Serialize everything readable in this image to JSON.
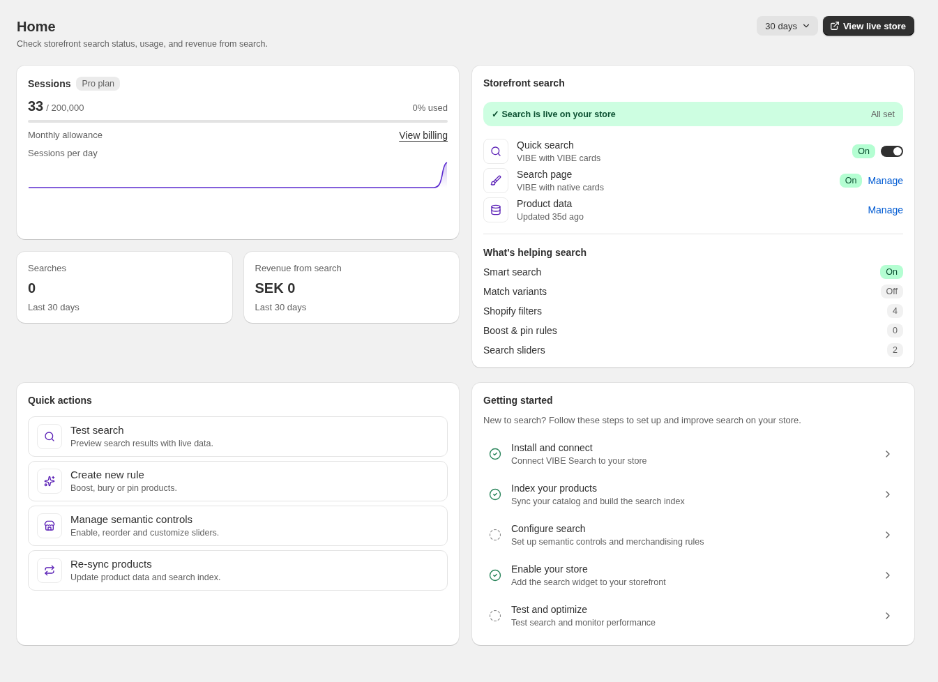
{
  "header": {
    "title": "Home",
    "subtitle": "Check storefront search status, usage, and revenue from search.",
    "period_select": {
      "value": "30 days"
    },
    "view_store_button": "View live store"
  },
  "sessions": {
    "title": "Sessions",
    "plan_badge": "Pro plan",
    "count": "33",
    "limit": "/ 200,000",
    "usage": "0% used",
    "allowance_label": "Monthly allowance",
    "billing_link": "View billing",
    "chart_title": "Sessions per day"
  },
  "stats": [
    {
      "label": "Searches",
      "value": "0",
      "period": "Last 30 days"
    },
    {
      "label": "Revenue from search",
      "value": "SEK 0",
      "period": "Last 30 days"
    }
  ],
  "storefront": {
    "title": "Storefront search",
    "banner": {
      "check": "✓",
      "message": "Search is live on your store",
      "status": "All set"
    },
    "features": [
      {
        "title": "Quick search",
        "subtitle": "VIBE with VIBE cards",
        "badge": {
          "label": "On",
          "active": true
        },
        "toggle": {
          "on": true
        }
      },
      {
        "title": "Search page",
        "subtitle": "VIBE with native cards",
        "badge": {
          "label": "On",
          "active": true
        },
        "action": "Manage"
      },
      {
        "title": "Product data",
        "subtitle": "Updated 35d ago",
        "action": "Manage"
      }
    ],
    "helpers_title": "What's helping search",
    "helpers": [
      {
        "label": "Smart search",
        "badge": {
          "label": "On",
          "active": true
        }
      },
      {
        "label": "Match variants",
        "badge": {
          "label": "Off",
          "active": false
        }
      },
      {
        "label": "Shopify filters",
        "badge": {
          "label": "4",
          "active": false
        }
      },
      {
        "label": "Boost & pin rules",
        "badge": {
          "label": "0",
          "active": false
        }
      },
      {
        "label": "Search sliders",
        "badge": {
          "label": "2",
          "active": false
        }
      }
    ]
  },
  "quick_actions": {
    "title": "Quick actions",
    "items": [
      {
        "title": "Test search",
        "description": "Preview search results with live data."
      },
      {
        "title": "Create new rule",
        "description": "Boost, bury or pin products."
      },
      {
        "title": "Manage semantic controls",
        "description": "Enable, reorder and customize sliders."
      },
      {
        "title": "Re-sync products",
        "description": "Update product data and search index."
      }
    ]
  },
  "getting_started": {
    "title": "Getting started",
    "description": "New to search? Follow these steps to set up and improve search on your store.",
    "steps": [
      {
        "title": "Install and connect",
        "description": "Connect VIBE Search to your store",
        "done": true
      },
      {
        "title": "Index your products",
        "description": "Sync your catalog and build the search index",
        "done": true
      },
      {
        "title": "Configure search",
        "description": "Set up semantic controls and merchandising rules",
        "done": false
      },
      {
        "title": "Enable your store",
        "description": "Add the search widget to your storefront",
        "done": true
      },
      {
        "title": "Test and optimize",
        "description": "Test search and monitor performance",
        "done": false
      }
    ]
  }
}
